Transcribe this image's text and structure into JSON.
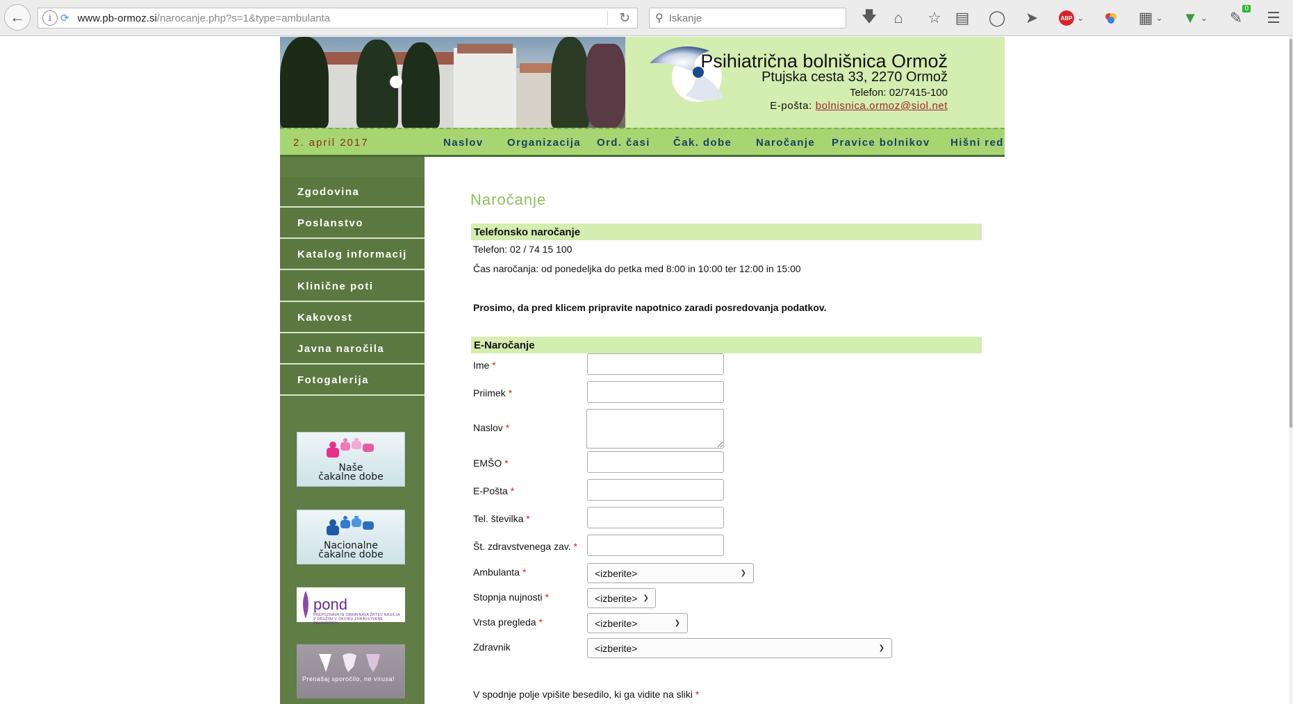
{
  "browser": {
    "url_host": "www.pb-ormoz.si",
    "url_path": "/narocanje.php?s=1&type=ambulanta",
    "search_placeholder": "Iskanje",
    "extension_badge": "0"
  },
  "header": {
    "title": "Psihiatrična bolnišnica Ormož",
    "address": "Ptujska cesta 33, 2270 Ormož",
    "phone": "Telefon: 02/7415-100",
    "email_label": "E-pošta:",
    "email": "bolnisnica.ormoz@siol.net"
  },
  "navbar": {
    "date": "2. april 2017",
    "items": [
      "Naslov",
      "Organizacija",
      "Ord. časi",
      "Čak. dobe",
      "Naročanje",
      "Pravice bolnikov",
      "Hišni red"
    ]
  },
  "sidebar": {
    "items": [
      "Zgodovina",
      "Poslanstvo",
      "Katalog informacij",
      "Klinične poti",
      "Kakovost",
      "Javna naročila",
      "Fotogalerija"
    ],
    "banners": {
      "wait_times_line1": "Naše",
      "wait_times_line2": "čakalne dobe",
      "national_line1": "Nacionalne",
      "national_line2": "čakalne dobe",
      "pond_word": "pond",
      "pond_sub": "PREPOZNAVA IN OBRAVNAVA ŽRTEV NASILJA V DRUŽINI V OKVIRU ZDRAVSTVENE DEJAVNOSTI",
      "mosaic_text": "Prenašaj sporočilo, ne virusa!"
    }
  },
  "content": {
    "title": "Naročanje",
    "phone_section": {
      "heading": "Telefonsko naročanje",
      "phone": "Telefon: 02 / 74 15 100",
      "hours": "Čas naročanja: od ponedeljka do petka med 8:00 in 10:00 ter 12:00 in 15:00",
      "note": "Prosimo, da pred klicem pripravite napotnico zaradi posredovanja podatkov."
    },
    "form": {
      "heading": "E-Naročanje",
      "required_mark": "*",
      "fields": {
        "ime": "Ime",
        "priimek": "Priimek",
        "naslov": "Naslov",
        "emso": "EMŠO",
        "eposta": "E-Pošta",
        "tel": "Tel. številka",
        "zzzs": "Št. zdravstvenega zav.",
        "ambulanta": "Ambulanta",
        "nujnost": "Stopnja nujnosti",
        "vrsta": "Vrsta pregleda",
        "zdravnik": "Zdravnik"
      },
      "select_default": "<izberite>",
      "captcha_prompt": "V spodnje polje vpišite besedilo, ki ga vidite na sliki"
    }
  }
}
